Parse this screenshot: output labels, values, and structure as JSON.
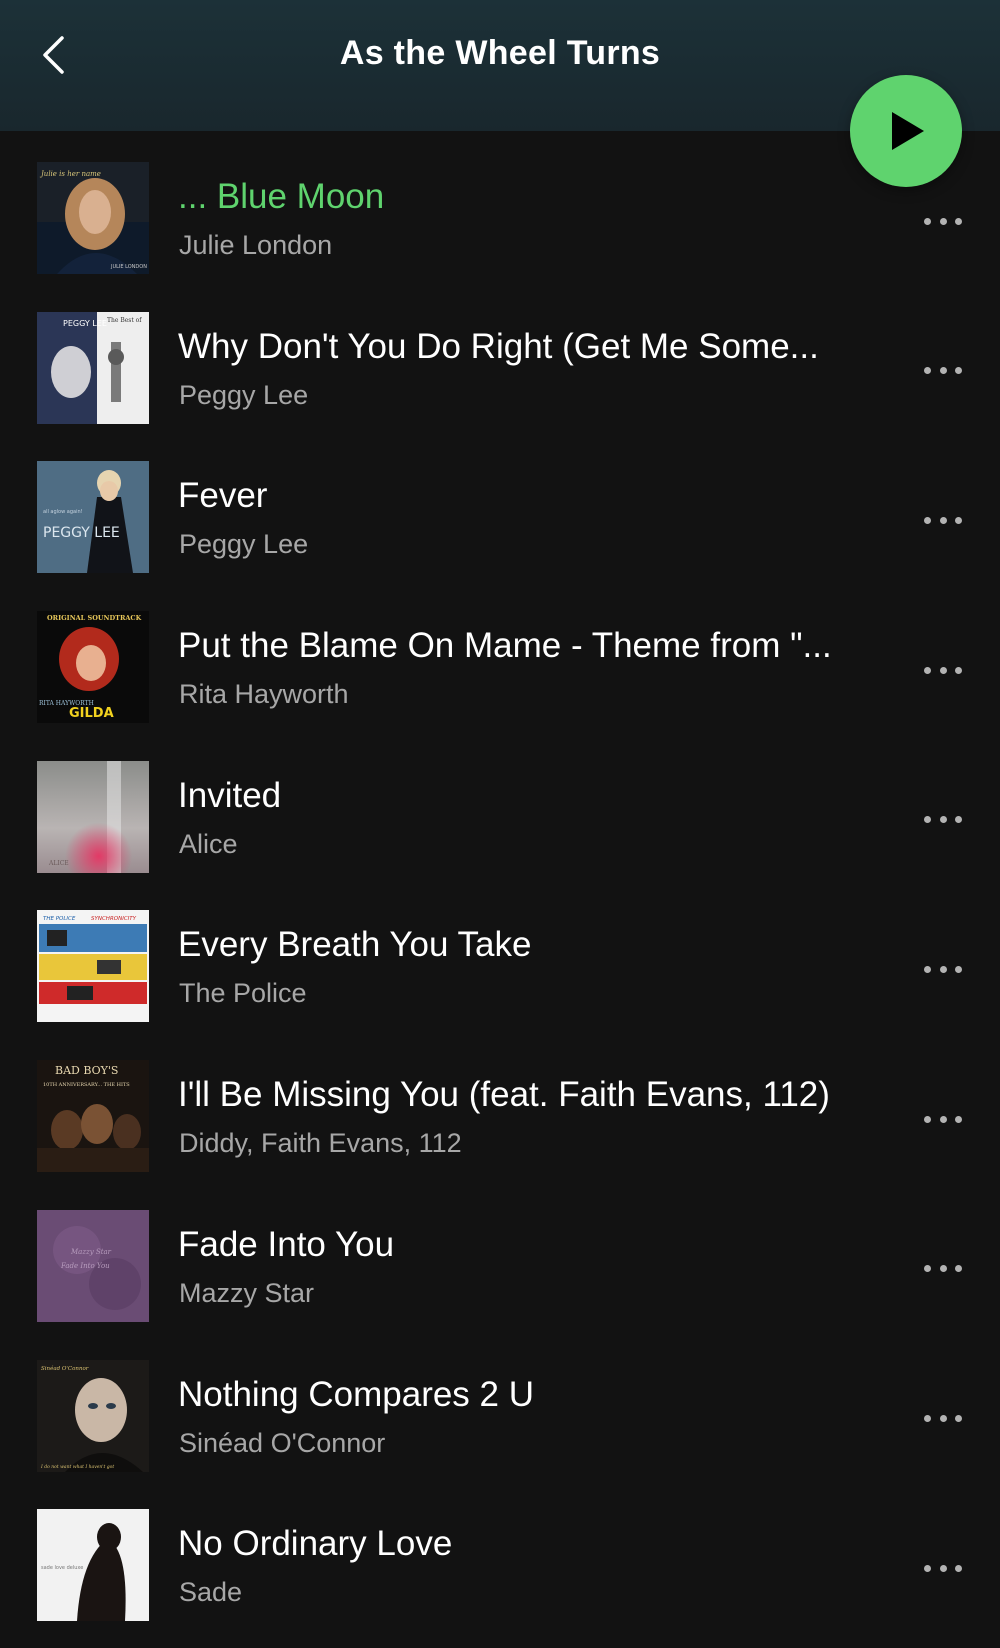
{
  "header": {
    "title": "As the Wheel Turns",
    "back_icon": "chevron-left-icon",
    "play_icon": "play-icon"
  },
  "colors": {
    "accent": "#5fd36e",
    "background": "#121212",
    "header_bg": "#1c3138",
    "secondary_text": "#a7a7a7"
  },
  "tracks": [
    {
      "title": "... Blue Moon",
      "artist": "Julie London",
      "active": true
    },
    {
      "title": "Why Don't You Do Right (Get Me Some...",
      "artist": "Peggy Lee",
      "active": false
    },
    {
      "title": "Fever",
      "artist": "Peggy Lee",
      "active": false
    },
    {
      "title": "Put the Blame On Mame - Theme from \"...",
      "artist": "Rita Hayworth",
      "active": false
    },
    {
      "title": "Invited",
      "artist": "Alice",
      "active": false
    },
    {
      "title": "Every Breath You Take",
      "artist": "The Police",
      "active": false
    },
    {
      "title": "I'll Be Missing You (feat. Faith Evans, 112)",
      "artist": "Diddy, Faith Evans, 112",
      "active": false
    },
    {
      "title": "Fade Into You",
      "artist": "Mazzy Star",
      "active": false
    },
    {
      "title": "Nothing Compares 2 U",
      "artist": "Sinéad O'Connor",
      "active": false
    },
    {
      "title": "No Ordinary Love",
      "artist": "Sade",
      "active": false
    }
  ],
  "album_covers": [
    {
      "text_1": "Julie is her name",
      "text_2": "JULIE LONDON"
    },
    {
      "text_1": "PEGGY LEE",
      "text_2": "The Best of"
    },
    {
      "text_1": "PEGGY LEE",
      "text_2": "all aglow again!"
    },
    {
      "text_1": "ORIGINAL SOUNDTRACK",
      "text_2": "RITA HAYWORTH",
      "text_3": "GILDA"
    },
    {
      "text_1": "ALICE"
    },
    {
      "text_1": "THE POLICE",
      "text_2": "SYNCHRONICITY"
    },
    {
      "text_1": "BAD BOY'S",
      "text_2": "10TH ANNIVERSARY... THE HITS"
    },
    {
      "text_1": "Mazzy Star",
      "text_2": "Fade Into You"
    },
    {
      "text_1": "Sinéad O'Connor",
      "text_2": "I do not want what I haven't got"
    },
    {
      "text_1": "sade love deluxe"
    }
  ]
}
